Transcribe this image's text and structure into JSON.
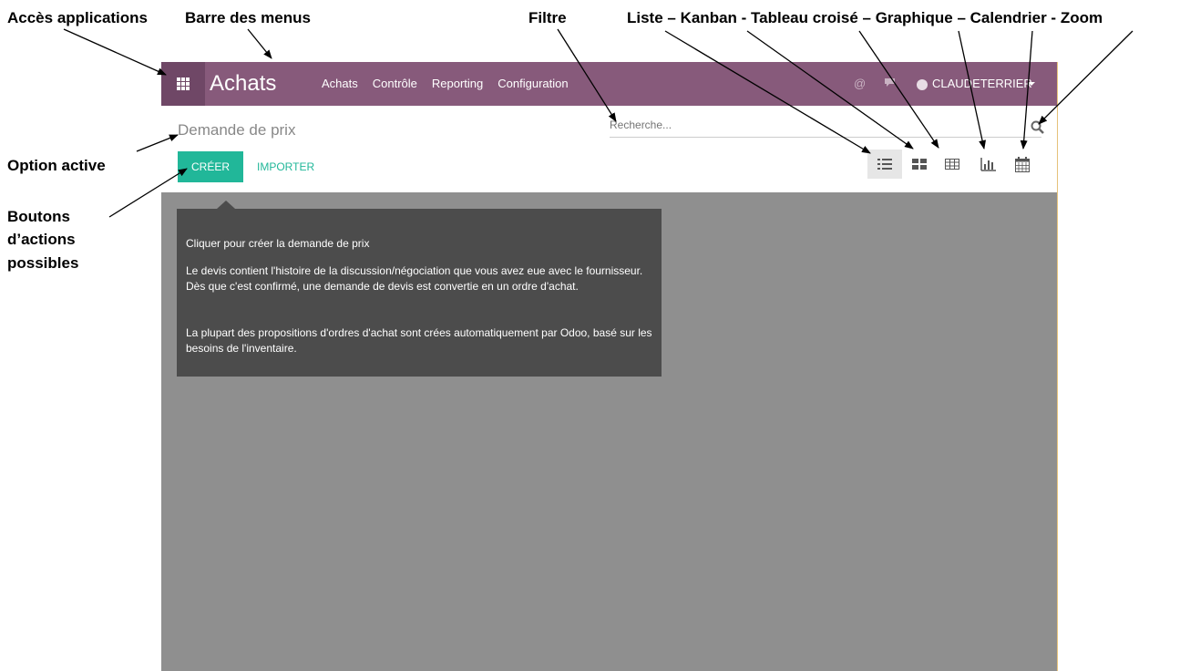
{
  "annotations": {
    "apps_access": "Accès applications",
    "menu_bar": "Barre des menus",
    "filter": "Filtre",
    "views": "Liste – Kanban - Tableau croisé – Graphique – Calendrier - Zoom",
    "active_option": "Option active",
    "action_buttons_1": "Boutons",
    "action_buttons_2": "d’actions",
    "action_buttons_3": "possibles"
  },
  "navbar": {
    "app_title": "Achats",
    "menu": [
      "Achats",
      "Contrôle",
      "Reporting",
      "Configuration"
    ],
    "icons": [
      "at-icon",
      "chat-icon"
    ],
    "user": "CLAUDETERRIER",
    "color": "#875a7b",
    "apps_button_color": "#6f4766"
  },
  "control_panel": {
    "breadcrumb": "Demande de prix",
    "search_placeholder": "Recherche...",
    "create_label": "CRÉER",
    "import_label": "IMPORTER",
    "accent": "#21b799",
    "views": [
      "list",
      "kanban",
      "pivot",
      "graph",
      "calendar"
    ],
    "active_view": "list"
  },
  "help": {
    "line1": "Cliquer pour créer la demande de prix",
    "line2": "Le devis contient l'histoire de la discussion/négociation que vous avez eue avec le fournisseur. Dès que c'est confirmé, une demande de devis est convertie en un ordre d'achat.",
    "line3": "La plupart des propositions d'ordres d'achat sont crées automatiquement par Odoo, basé sur les besoins de l'inventaire."
  }
}
